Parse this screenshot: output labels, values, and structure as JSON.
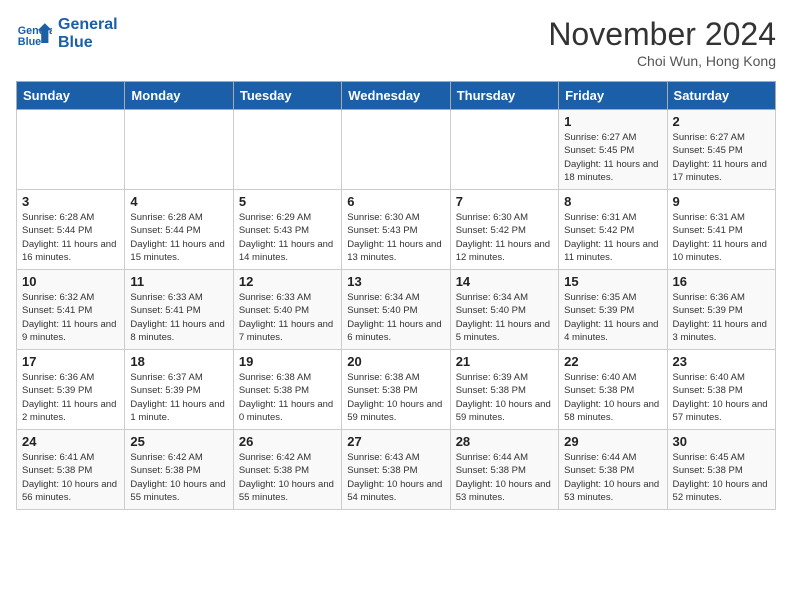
{
  "header": {
    "logo_line1": "General",
    "logo_line2": "Blue",
    "month": "November 2024",
    "location": "Choi Wun, Hong Kong"
  },
  "days_of_week": [
    "Sunday",
    "Monday",
    "Tuesday",
    "Wednesday",
    "Thursday",
    "Friday",
    "Saturday"
  ],
  "weeks": [
    [
      {
        "day": "",
        "info": ""
      },
      {
        "day": "",
        "info": ""
      },
      {
        "day": "",
        "info": ""
      },
      {
        "day": "",
        "info": ""
      },
      {
        "day": "",
        "info": ""
      },
      {
        "day": "1",
        "info": "Sunrise: 6:27 AM\nSunset: 5:45 PM\nDaylight: 11 hours and 18 minutes."
      },
      {
        "day": "2",
        "info": "Sunrise: 6:27 AM\nSunset: 5:45 PM\nDaylight: 11 hours and 17 minutes."
      }
    ],
    [
      {
        "day": "3",
        "info": "Sunrise: 6:28 AM\nSunset: 5:44 PM\nDaylight: 11 hours and 16 minutes."
      },
      {
        "day": "4",
        "info": "Sunrise: 6:28 AM\nSunset: 5:44 PM\nDaylight: 11 hours and 15 minutes."
      },
      {
        "day": "5",
        "info": "Sunrise: 6:29 AM\nSunset: 5:43 PM\nDaylight: 11 hours and 14 minutes."
      },
      {
        "day": "6",
        "info": "Sunrise: 6:30 AM\nSunset: 5:43 PM\nDaylight: 11 hours and 13 minutes."
      },
      {
        "day": "7",
        "info": "Sunrise: 6:30 AM\nSunset: 5:42 PM\nDaylight: 11 hours and 12 minutes."
      },
      {
        "day": "8",
        "info": "Sunrise: 6:31 AM\nSunset: 5:42 PM\nDaylight: 11 hours and 11 minutes."
      },
      {
        "day": "9",
        "info": "Sunrise: 6:31 AM\nSunset: 5:41 PM\nDaylight: 11 hours and 10 minutes."
      }
    ],
    [
      {
        "day": "10",
        "info": "Sunrise: 6:32 AM\nSunset: 5:41 PM\nDaylight: 11 hours and 9 minutes."
      },
      {
        "day": "11",
        "info": "Sunrise: 6:33 AM\nSunset: 5:41 PM\nDaylight: 11 hours and 8 minutes."
      },
      {
        "day": "12",
        "info": "Sunrise: 6:33 AM\nSunset: 5:40 PM\nDaylight: 11 hours and 7 minutes."
      },
      {
        "day": "13",
        "info": "Sunrise: 6:34 AM\nSunset: 5:40 PM\nDaylight: 11 hours and 6 minutes."
      },
      {
        "day": "14",
        "info": "Sunrise: 6:34 AM\nSunset: 5:40 PM\nDaylight: 11 hours and 5 minutes."
      },
      {
        "day": "15",
        "info": "Sunrise: 6:35 AM\nSunset: 5:39 PM\nDaylight: 11 hours and 4 minutes."
      },
      {
        "day": "16",
        "info": "Sunrise: 6:36 AM\nSunset: 5:39 PM\nDaylight: 11 hours and 3 minutes."
      }
    ],
    [
      {
        "day": "17",
        "info": "Sunrise: 6:36 AM\nSunset: 5:39 PM\nDaylight: 11 hours and 2 minutes."
      },
      {
        "day": "18",
        "info": "Sunrise: 6:37 AM\nSunset: 5:39 PM\nDaylight: 11 hours and 1 minute."
      },
      {
        "day": "19",
        "info": "Sunrise: 6:38 AM\nSunset: 5:38 PM\nDaylight: 11 hours and 0 minutes."
      },
      {
        "day": "20",
        "info": "Sunrise: 6:38 AM\nSunset: 5:38 PM\nDaylight: 10 hours and 59 minutes."
      },
      {
        "day": "21",
        "info": "Sunrise: 6:39 AM\nSunset: 5:38 PM\nDaylight: 10 hours and 59 minutes."
      },
      {
        "day": "22",
        "info": "Sunrise: 6:40 AM\nSunset: 5:38 PM\nDaylight: 10 hours and 58 minutes."
      },
      {
        "day": "23",
        "info": "Sunrise: 6:40 AM\nSunset: 5:38 PM\nDaylight: 10 hours and 57 minutes."
      }
    ],
    [
      {
        "day": "24",
        "info": "Sunrise: 6:41 AM\nSunset: 5:38 PM\nDaylight: 10 hours and 56 minutes."
      },
      {
        "day": "25",
        "info": "Sunrise: 6:42 AM\nSunset: 5:38 PM\nDaylight: 10 hours and 55 minutes."
      },
      {
        "day": "26",
        "info": "Sunrise: 6:42 AM\nSunset: 5:38 PM\nDaylight: 10 hours and 55 minutes."
      },
      {
        "day": "27",
        "info": "Sunrise: 6:43 AM\nSunset: 5:38 PM\nDaylight: 10 hours and 54 minutes."
      },
      {
        "day": "28",
        "info": "Sunrise: 6:44 AM\nSunset: 5:38 PM\nDaylight: 10 hours and 53 minutes."
      },
      {
        "day": "29",
        "info": "Sunrise: 6:44 AM\nSunset: 5:38 PM\nDaylight: 10 hours and 53 minutes."
      },
      {
        "day": "30",
        "info": "Sunrise: 6:45 AM\nSunset: 5:38 PM\nDaylight: 10 hours and 52 minutes."
      }
    ]
  ]
}
